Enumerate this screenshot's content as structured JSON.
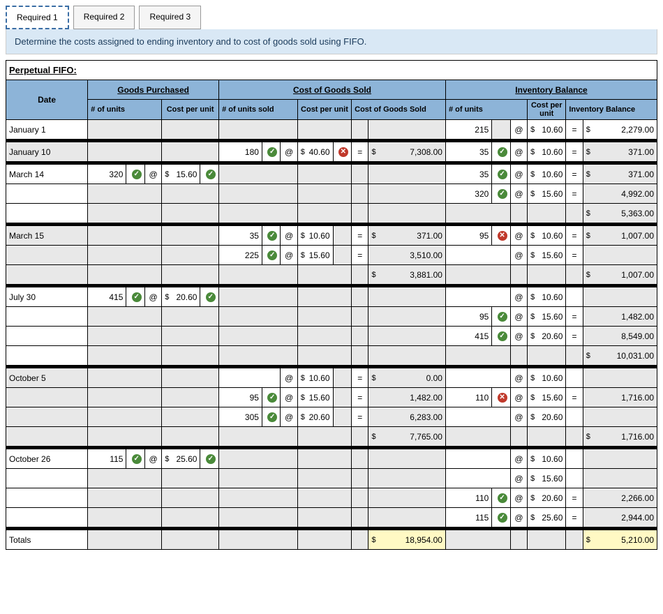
{
  "tabs": [
    "Required 1",
    "Required 2",
    "Required 3"
  ],
  "instruction": "Determine the costs assigned to ending inventory and to cost of goods sold using FIFO.",
  "section_title": "Perpetual FIFO:",
  "group_headers": [
    "Goods Purchased",
    "Cost of Goods Sold",
    "Inventory Balance"
  ],
  "col_headers": {
    "date": "Date",
    "gp_units": "# of\nunits",
    "gp_cost": "Cost\nper\nunit",
    "cogs_units": "# of units sold",
    "cogs_cost": "Cost\nper\nunit",
    "cogs_total": "Cost of Goods Sold",
    "ib_units": "# of units",
    "ib_cost": "Cost\nper\nunit",
    "ib_total": "Inventory Balance"
  },
  "at": "@",
  "eq": "=",
  "rows": {
    "jan1": {
      "date": "January 1",
      "ib_units": "215",
      "ib_cost": "10.60",
      "ib_total": "2,279.00"
    },
    "jan10": {
      "date": "January 10",
      "cogs_units": "180",
      "cogs_cost": "40.60",
      "cogs_total": "7,308.00",
      "ib_units": "35",
      "ib_cost": "10.60",
      "ib_total": "371.00"
    },
    "mar14a": {
      "date": "March 14",
      "gp_units": "320",
      "gp_cost": "15.60",
      "ib_units": "35",
      "ib_cost": "10.60",
      "ib_total": "371.00"
    },
    "mar14b": {
      "ib_units": "320",
      "ib_cost": "15.60",
      "ib_total": "4,992.00"
    },
    "mar14c": {
      "ib_total": "5,363.00"
    },
    "mar15a": {
      "date": "March 15",
      "cogs_units": "35",
      "cogs_cost": "10.60",
      "cogs_total": "371.00",
      "ib_units": "95",
      "ib_cost": "10.60",
      "ib_total": "1,007.00"
    },
    "mar15b": {
      "cogs_units": "225",
      "cogs_cost": "15.60",
      "cogs_total": "3,510.00",
      "ib_cost": "15.60"
    },
    "mar15c": {
      "cogs_total": "3,881.00",
      "ib_total": "1,007.00"
    },
    "jul30a": {
      "date": "July 30",
      "gp_units": "415",
      "gp_cost": "20.60",
      "ib_cost": "10.60"
    },
    "jul30b": {
      "ib_units": "95",
      "ib_cost": "15.60",
      "ib_total": "1,482.00"
    },
    "jul30c": {
      "ib_units": "415",
      "ib_cost": "20.60",
      "ib_total": "8,549.00"
    },
    "jul30d": {
      "ib_total": "10,031.00"
    },
    "oct5a": {
      "date": "October 5",
      "cogs_cost": "10.60",
      "cogs_total": "0.00",
      "ib_cost": "10.60"
    },
    "oct5b": {
      "cogs_units": "95",
      "cogs_cost": "15.60",
      "cogs_total": "1,482.00",
      "ib_units": "110",
      "ib_cost": "15.60",
      "ib_total": "1,716.00"
    },
    "oct5c": {
      "cogs_units": "305",
      "cogs_cost": "20.60",
      "cogs_total": "6,283.00",
      "ib_cost": "20.60"
    },
    "oct5d": {
      "cogs_total": "7,765.00",
      "ib_total": "1,716.00"
    },
    "oct26a": {
      "date": "October 26",
      "gp_units": "115",
      "gp_cost": "25.60",
      "ib_cost": "10.60"
    },
    "oct26b": {
      "ib_cost": "15.60"
    },
    "oct26c": {
      "ib_units": "110",
      "ib_cost": "20.60",
      "ib_total": "2,266.00"
    },
    "oct26d": {
      "ib_units": "115",
      "ib_cost": "25.60",
      "ib_total": "2,944.00"
    },
    "totals": {
      "date": "Totals",
      "cogs_total": "18,954.00",
      "ib_total": "5,210.00"
    }
  }
}
